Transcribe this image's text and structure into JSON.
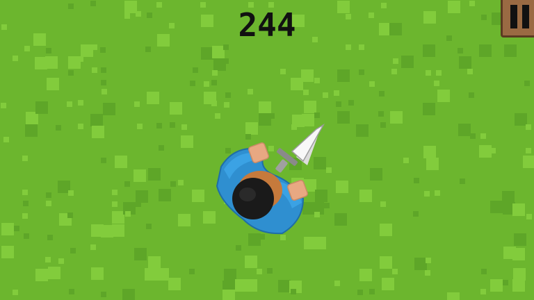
{
  "hud": {
    "score": "244",
    "pause_icon": "pause-icon"
  },
  "colors": {
    "grass": "#6cb62e",
    "grass_light": "#82cc3c",
    "grass_dark": "#5ea628",
    "score_text": "#111111",
    "pause_frame": "#9a6a43",
    "shirt": "#2f8fd0",
    "hair": "#1a1a1a",
    "skin": "#e8a882",
    "sword_blade": "#f4f4f4"
  },
  "player": {
    "character": "swordsman-topdown"
  }
}
